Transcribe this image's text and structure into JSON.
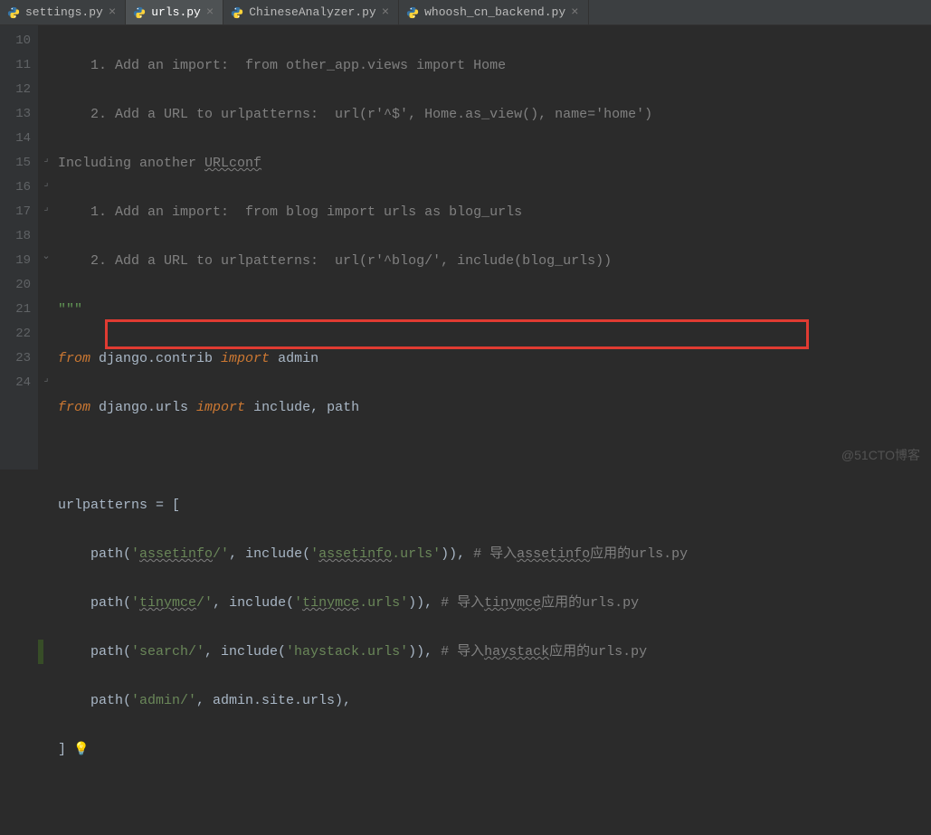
{
  "tabs": [
    {
      "label": "settings.py",
      "active": false
    },
    {
      "label": "urls.py",
      "active": true
    },
    {
      "label": "ChineseAnalyzer.py",
      "active": false
    },
    {
      "label": "whoosh_cn_backend.py",
      "active": false
    }
  ],
  "gutter_start": 10,
  "gutter_end": 24,
  "lines": {
    "l10": "    1. Add an import:  from other_app.views import Home",
    "l11": "    2. Add a URL to urlpatterns:  url(r'^$', Home.as_view(), name='home')",
    "l12": "Including another URLconf",
    "l13": "    1. Add an import:  from blog import urls as blog_urls",
    "l14": "    2. Add a URL to urlpatterns:  url(r'^blog/', include(blog_urls))",
    "l15": "\"\"\"",
    "l16_from": "from ",
    "l16_mod": "django.contrib ",
    "l16_imp": "import ",
    "l16_name": "admin",
    "l17_from": "from ",
    "l17_mod": "django.urls ",
    "l17_imp": "import ",
    "l17_name": "include, path",
    "l19": "urlpatterns = [",
    "l20_a": "    path(",
    "l20_b": "'assetinfo/'",
    "l20_c": ", include(",
    "l20_d": "'assetinfo.urls'",
    "l20_e": ")), ",
    "l20_f": "# 导入assetinfo应用的urls.py",
    "l21_a": "    path(",
    "l21_b": "'tinymce/'",
    "l21_c": ", include(",
    "l21_d": "'tinymce.urls'",
    "l21_e": ")), ",
    "l21_f": "# 导入tinymce应用的urls.py",
    "l22_a": "    path(",
    "l22_b": "'search/'",
    "l22_c": ", include(",
    "l22_d": "'haystack.urls'",
    "l22_e": ")), ",
    "l22_f": "# 导入haystack应用的urls.py",
    "l23_a": "    path(",
    "l23_b": "'admin/'",
    "l23_c": ", admin.site.urls),",
    "l24": "]"
  },
  "watermark": "@51CTO博客"
}
